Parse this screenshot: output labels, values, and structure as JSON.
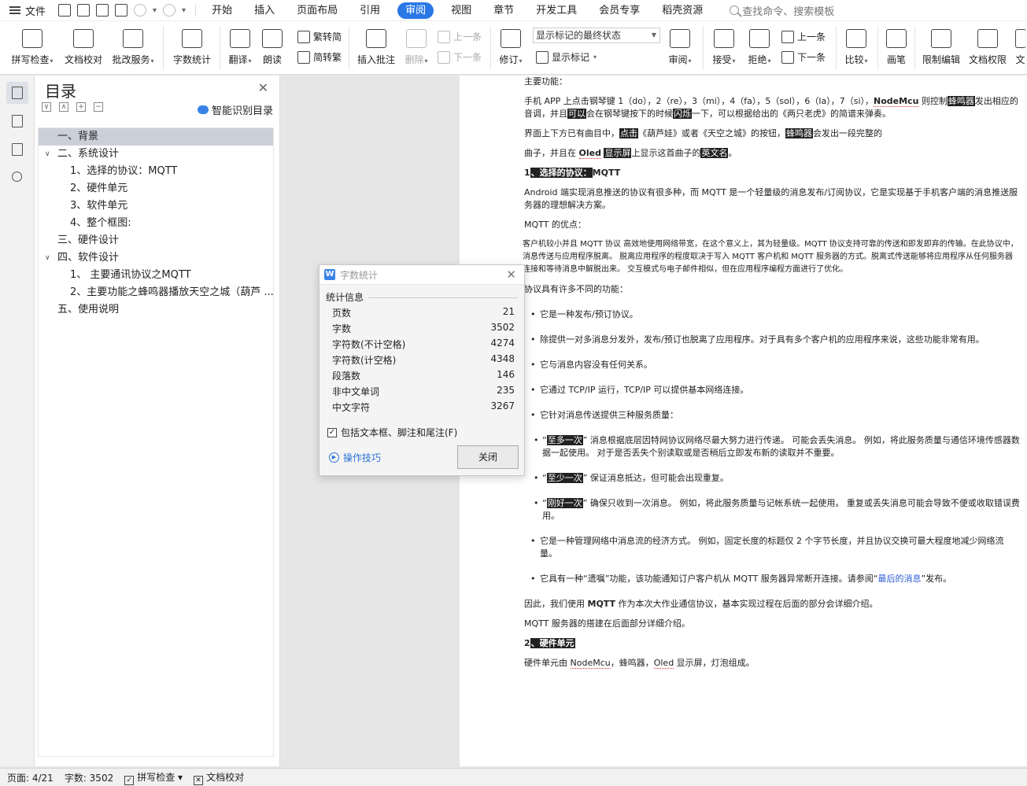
{
  "menubar": {
    "file_label": "文件",
    "tabs": [
      "开始",
      "插入",
      "页面布局",
      "引用",
      "审阅",
      "视图",
      "章节",
      "开发工具",
      "会员专享",
      "稻壳资源"
    ],
    "active_tab": "审阅",
    "search_placeholder": "查找命令、搜索模板"
  },
  "ribbon": {
    "spell_check": "拼写检查",
    "doc_proof": "文档校对",
    "batch_service": "批改服务",
    "word_count": "字数统计",
    "translate": "翻译",
    "read_aloud": "朗读",
    "trad_convert": "繁转简",
    "simp_convert": "简转繁",
    "insert_comment": "插入批注",
    "delete": "删除",
    "prev_comment": "上一条",
    "next_comment": "下一条",
    "revise": "修订",
    "show_markup_select": "显示标记的最终状态",
    "show_markup": "显示标记",
    "review": "审阅",
    "accept": "接受",
    "reject": "拒绝",
    "prev_change": "上一条",
    "next_change": "下一条",
    "compare": "比较",
    "pen": "画笔",
    "restrict_edit": "限制编辑",
    "doc_permission": "文档权限",
    "doc_more": "文"
  },
  "toc": {
    "title": "目录",
    "smart_detect": "智能识别目录",
    "items": [
      {
        "label": "一、背景",
        "level": 0,
        "twisty": "",
        "selected": true
      },
      {
        "label": "二、系统设计",
        "level": 0,
        "twisty": "∨",
        "selected": false
      },
      {
        "label": "1、选择的协议：MQTT",
        "level": 1,
        "twisty": "",
        "selected": false
      },
      {
        "label": "2、硬件单元",
        "level": 1,
        "twisty": "",
        "selected": false
      },
      {
        "label": "3、软件单元",
        "level": 1,
        "twisty": "",
        "selected": false
      },
      {
        "label": "4、整个框图:",
        "level": 1,
        "twisty": "",
        "selected": false
      },
      {
        "label": "三、硬件设计",
        "level": 0,
        "twisty": "",
        "selected": false
      },
      {
        "label": "四、软件设计",
        "level": 0,
        "twisty": "∨",
        "selected": false
      },
      {
        "label": "1、 主要通讯协议之MQTT",
        "level": 1,
        "twisty": "",
        "selected": false
      },
      {
        "label": "2、主要功能之蜂鸣器播放天空之城（葫芦 ...",
        "level": 1,
        "twisty": "",
        "selected": false
      },
      {
        "label": "五、使用说明",
        "level": 0,
        "twisty": "",
        "selected": false
      }
    ]
  },
  "dialog": {
    "title": "字数统计",
    "group_title": "统计信息",
    "stats": [
      {
        "label": "页数",
        "value": "21"
      },
      {
        "label": "字数",
        "value": "3502"
      },
      {
        "label": "字符数(不计空格)",
        "value": "4274"
      },
      {
        "label": "字符数(计空格)",
        "value": "4348"
      },
      {
        "label": "段落数",
        "value": "146"
      },
      {
        "label": "非中文单词",
        "value": "235"
      },
      {
        "label": "中文字符",
        "value": "3267"
      }
    ],
    "include_checkbox": "包括文本框、脚注和尾注(F)",
    "tips_link": "操作技巧",
    "close_button": "关闭"
  },
  "document": {
    "p1": "主要功能：",
    "p2a": "手机 APP 上点击钢琴键 1（do），2（re），3（mi），4（fa），5（sol），6（la），7（si），",
    "p2b": "NodeMcu",
    "p2c": " 则控制",
    "p2d": "蜂鸣器",
    "p2e": "发出相应的音调，并且",
    "p2f": "可以",
    "p2g": "会在钢琴键按下的时候",
    "p2h": "闪烁",
    "p2i": "一下，可以根据给出的《两只老虎》的简谱来弹奏。",
    "p3a": "界面上下方已有曲目中，",
    "p3b": "点击",
    "p3c": "《葫芦娃》或者《天空之城》的按钮，",
    "p3d": "蜂鸣器",
    "p3e": "会发出一段完整的",
    "p4a": "曲子，并且在 ",
    "p4b": "Oled",
    "p4c": " ",
    "p4d": "显示屏",
    "p4e": "上显示这首曲子的",
    "p4f": "英文名",
    "p4g": "。",
    "h1a": "1",
    "h1b": "、选择的协议：",
    "h1c": "MQTT",
    "p5": "Android 端实现消息推送的协议有很多种，而 MQTT 是一个轻量级的消息发布/订阅协议，它是实现基于手机客户端的消息推送服务器的理想解决方案。",
    "p6": "MQTT 的优点：",
    "p7": "客户机较小并且 MQTT 协议 高效地使用网络带宽，在这个意义上，其为轻量级。MQTT 协议支持可靠的传送和即发即弃的传输。在此协议中，消息传送与应用程序脱离。 脱离应用程序的程度取决于写入 MQTT 客户机和 MQTT 服务器的方式。脱离式传送能够将应用程序从任何服务器连接和等待消息中解脱出来。 交互模式与电子邮件相似，但在应用程序编程方面进行了优化。",
    "p8": "协议具有许多不同的功能：",
    "b1": "它是一种发布/预订协议。",
    "b2": "除提供一对多消息分发外，发布/预订也脱离了应用程序。对于具有多个客户机的应用程序来说，这些功能非常有用。",
    "b3": "它与消息内容没有任何关系。",
    "b4": "它通过  TCP/IP  运行，TCP/IP  可以提供基本网络连接。",
    "b5": "它针对消息传送提供三种服务质量：",
    "s1a": "“",
    "s1b": "至多一次",
    "s1c": "” 消息根据底层因特网协议网络尽最大努力进行传递。 可能会丢失消息。 例如，将此服务质量与通信环境传感器数据一起使用。 对于是否丢失个别读取或是否稍后立即发布新的读取并不重要。",
    "s2a": "“",
    "s2b": "至少一次",
    "s2c": "” 保证消息抵达，但可能会出现重复。",
    "s3a": "“",
    "s3b": "刚好一次",
    "s3c": "” 确保只收到一次消息。 例如，将此服务质量与记帐系统一起使用。 重复或丢失消息可能会导致不便或收取错误费用。",
    "b6": "它是一种管理网络中消息流的经济方式。 例如，固定长度的标题仅  2  个字节长度，并且协议交换可最大程度地减少网络流量。",
    "b7a": "它具有一种“遗嘱”功能，该功能通知订户客户机从  MQTT  服务器异常断开连接。请参阅“",
    "b7b": "最后的消息",
    "b7c": "”发布。",
    "p9a": "因此，我们使用 ",
    "p9b": "MQTT",
    "p9c": " 作为本次大作业通信协议，基本实现过程在后面的部分会详细介绍。",
    "p10": "MQTT 服务器的搭建在后面部分详细介绍。",
    "h2a": "2",
    "h2b": "、硬件单元",
    "p11a": "硬件单元由 ",
    "p11b": "NodeMcu",
    "p11c": "，蜂鸣器，",
    "p11d": "Oled",
    "p11e": " 显示屏，灯泡组成。"
  },
  "status": {
    "page": "页面: 4/21",
    "words": "字数: 3502",
    "spell": "拼写检查",
    "proof": "文档校对"
  }
}
